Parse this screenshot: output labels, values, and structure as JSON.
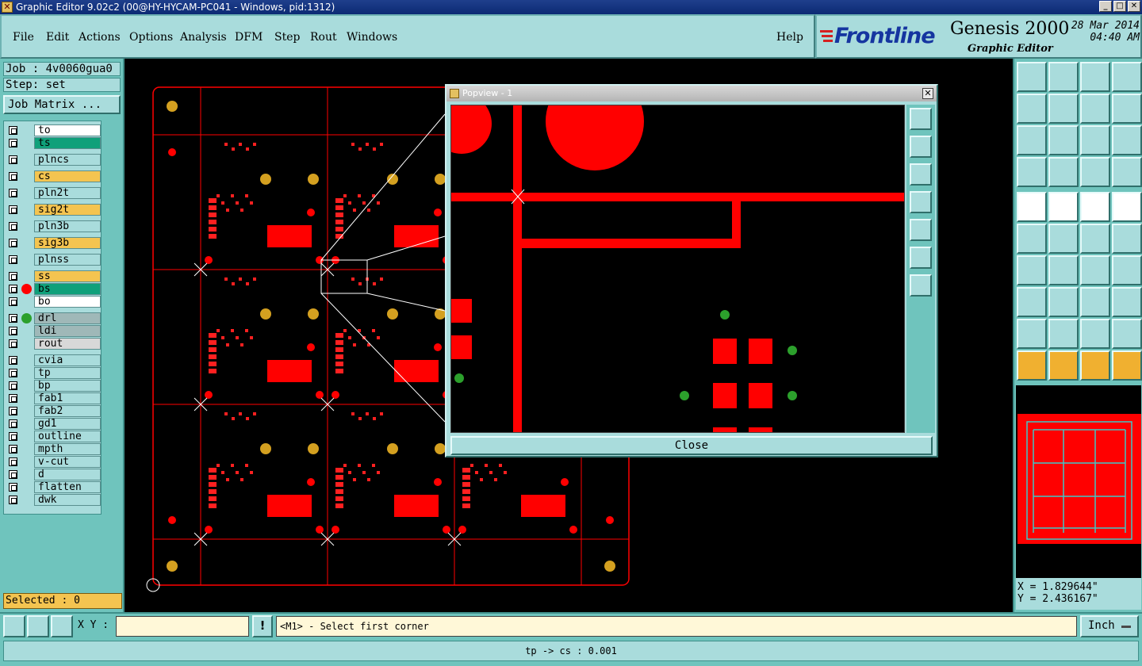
{
  "window": {
    "title": "Graphic Editor 9.02c2 (00@HY-HYCAM-PC041 - Windows, pid:1312)"
  },
  "menu": {
    "items": [
      "File",
      "Edit",
      "Actions",
      "Options",
      "Analysis",
      "DFM",
      "Step",
      "Rout",
      "Windows"
    ],
    "help": "Help"
  },
  "brand": {
    "logo": "Frontline",
    "product": "Genesis 2000",
    "subtitle": "Graphic Editor",
    "date": "28 Mar 2014",
    "time": "04:40 AM"
  },
  "job": {
    "job_label": "Job : 4v0060gua0",
    "step_label": "Step: set",
    "matrix_button": "Job Matrix ..."
  },
  "layers": [
    {
      "name": "to",
      "color": "#ffffff",
      "dot": ""
    },
    {
      "name": "ts",
      "color": "#0fa07a",
      "dot": ""
    },
    {
      "name": "plncs",
      "color": "#a9dcdc",
      "dot": ""
    },
    {
      "name": "cs",
      "color": "#f4c450",
      "dot": ""
    },
    {
      "name": "pln2t",
      "color": "#a9dcdc",
      "dot": ""
    },
    {
      "name": "sig2t",
      "color": "#f4c450",
      "dot": ""
    },
    {
      "name": "pln3b",
      "color": "#a9dcdc",
      "dot": ""
    },
    {
      "name": "sig3b",
      "color": "#f4c450",
      "dot": ""
    },
    {
      "name": "plnss",
      "color": "#a9dcdc",
      "dot": ""
    },
    {
      "name": "ss",
      "color": "#f4c450",
      "dot": ""
    },
    {
      "name": "bs",
      "color": "#0fa07a",
      "dot": "#ff0000"
    },
    {
      "name": "bo",
      "color": "#ffffff",
      "dot": ""
    },
    {
      "name": "drl",
      "color": "#9fb8b8",
      "dot": "#2ca02c"
    },
    {
      "name": "ldi",
      "color": "#9fb8b8",
      "dot": ""
    },
    {
      "name": "rout",
      "color": "#d8d8d8",
      "dot": ""
    },
    {
      "name": "cvia",
      "color": "#a9dcdc",
      "dot": ""
    },
    {
      "name": "tp",
      "color": "#a9dcdc",
      "dot": ""
    },
    {
      "name": "bp",
      "color": "#a9dcdc",
      "dot": ""
    },
    {
      "name": "fab1",
      "color": "#a9dcdc",
      "dot": ""
    },
    {
      "name": "fab2",
      "color": "#a9dcdc",
      "dot": ""
    },
    {
      "name": "gd1",
      "color": "#a9dcdc",
      "dot": ""
    },
    {
      "name": "outline",
      "color": "#a9dcdc",
      "dot": ""
    },
    {
      "name": "mpth",
      "color": "#a9dcdc",
      "dot": ""
    },
    {
      "name": "v-cut",
      "color": "#a9dcdc",
      "dot": ""
    },
    {
      "name": "d",
      "color": "#a9dcdc",
      "dot": ""
    },
    {
      "name": "flatten",
      "color": "#a9dcdc",
      "dot": ""
    },
    {
      "name": "dwk",
      "color": "#a9dcdc",
      "dot": ""
    }
  ],
  "selected_label": "Selected : 0",
  "popview": {
    "title": "Popview - 1",
    "close_label": "Close"
  },
  "coords": {
    "x_label": "X = 1.829644\"",
    "y_label": "Y = 2.436167\""
  },
  "bottom": {
    "xy_label": "X Y :",
    "xy_value": "",
    "excl": "!",
    "prompt": "<M1> - Select first corner",
    "units": "Inch"
  },
  "status": {
    "message": "tp -> cs : 0.001"
  },
  "colors": {
    "accent": "#a9dcdc",
    "panel": "#6fc4bd",
    "copper": "#ff0000",
    "drill": "#2ca02c",
    "pad_gold": "#d4a020"
  }
}
